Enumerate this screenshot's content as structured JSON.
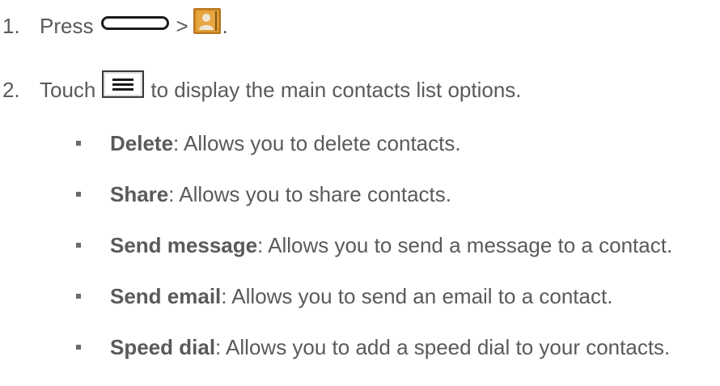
{
  "steps": [
    {
      "number": "1.",
      "text_before": "Press",
      "separator": ">",
      "end": ".",
      "icons": [
        "home-key-icon",
        "contacts-app-icon"
      ]
    },
    {
      "number": "2.",
      "text_before": "Touch",
      "text_after": "to display the main contacts list options.",
      "icons": [
        "menu-key-icon"
      ]
    }
  ],
  "options": [
    {
      "term": "Delete",
      "description": ": Allows you to delete contacts."
    },
    {
      "term": "Share",
      "description": ": Allows you to share contacts."
    },
    {
      "term": "Send message",
      "description": ": Allows you to send a message to a contact."
    },
    {
      "term": "Send email",
      "description": ": Allows you to send an email to a contact."
    },
    {
      "term": "Speed dial",
      "description": ": Allows you to add a speed dial to your contacts."
    }
  ],
  "colors": {
    "text": "#5a5a5a",
    "contacts_icon_frame": "#c98a2a",
    "contacts_icon_silhouette": "#d8cfc0"
  }
}
